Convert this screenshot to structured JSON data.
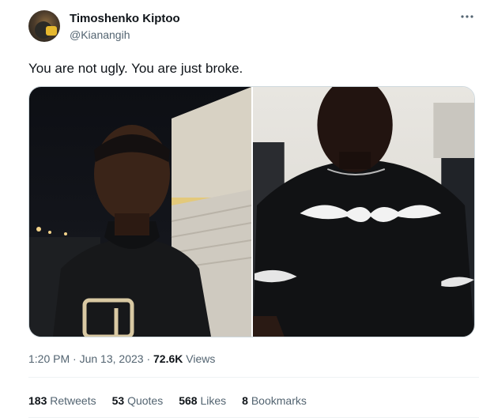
{
  "author": {
    "display_name": "Timoshenko Kiptoo",
    "handle": "@Kianangih"
  },
  "tweet": {
    "text": "You are not ugly. You are just broke.",
    "media": [
      {
        "alt": "Selfie at night wearing a black hoodie"
      },
      {
        "alt": "Selfie indoors wearing a black t-shirt with tribal print"
      }
    ]
  },
  "meta": {
    "time": "1:20 PM",
    "separator": "·",
    "date": "Jun 13, 2023",
    "views_count": "72.6K",
    "views_label": "Views"
  },
  "stats": {
    "retweets_count": "183",
    "retweets_label": "Retweets",
    "quotes_count": "53",
    "quotes_label": "Quotes",
    "likes_count": "568",
    "likes_label": "Likes",
    "bookmarks_count": "8",
    "bookmarks_label": "Bookmarks"
  },
  "icons": {
    "more": "more-horizontal-icon"
  },
  "colors": {
    "text_primary": "#0f1419",
    "text_secondary": "#536471",
    "border": "#cfd9de"
  }
}
